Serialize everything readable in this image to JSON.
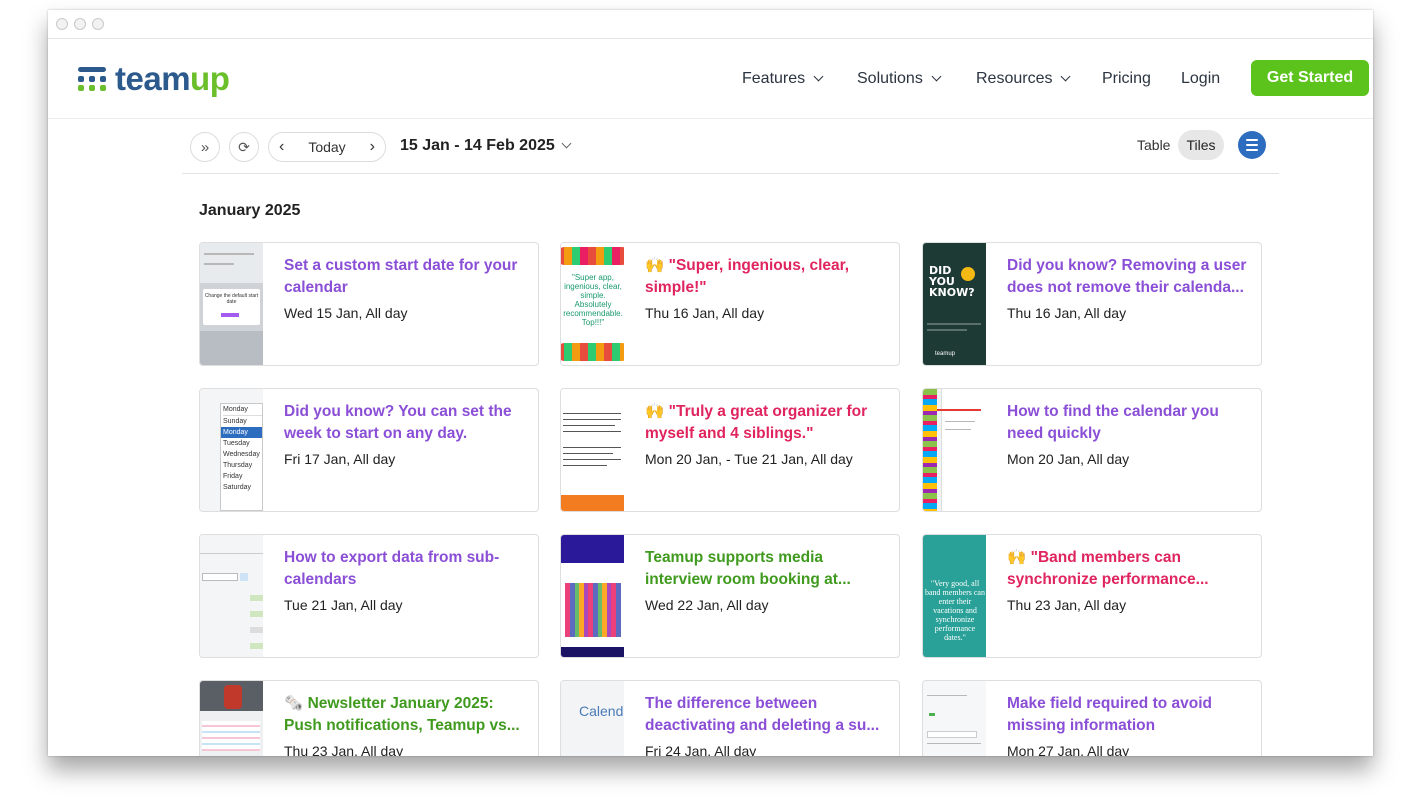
{
  "nav": {
    "logo_text_a": "team",
    "logo_text_b": "up",
    "features": "Features",
    "solutions": "Solutions",
    "resources": "Resources",
    "pricing": "Pricing",
    "login": "Login",
    "get_started": "Get Started"
  },
  "toolbar": {
    "today": "Today",
    "range": "15 Jan - 14 Feb 2025",
    "view_table": "Table",
    "view_tiles": "Tiles"
  },
  "month": "January 2025",
  "cards": [
    {
      "title": "Set a custom start date for your calendar",
      "date": "Wed 15 Jan, All day",
      "color": "#8a4fd6"
    },
    {
      "title": "🙌 \"Super, ingenious, clear, simple!\"",
      "date": "Thu 16 Jan, All day",
      "color": "#e0245e"
    },
    {
      "title": "Did you know? Removing a user does not remove their calenda...",
      "date": "Thu 16 Jan, All day",
      "color": "#8a4fd6"
    },
    {
      "title": "Did you know? You can set the week to start on any day.",
      "date": "Fri 17 Jan, All day",
      "color": "#8a4fd6"
    },
    {
      "title": "🙌 \"Truly a great organizer for myself and 4 siblings.\"",
      "date": "Mon 20 Jan, - Tue 21 Jan, All day",
      "color": "#e0245e"
    },
    {
      "title": "How to find the calendar you need quickly",
      "date": "Mon 20 Jan, All day",
      "color": "#8a4fd6"
    },
    {
      "title": "How to export data from sub-calendars",
      "date": "Tue 21 Jan, All day",
      "color": "#8a4fd6"
    },
    {
      "title": "Teamup supports media interview room booking at...",
      "date": "Wed 22 Jan, All day",
      "color": "#3f9a1e"
    },
    {
      "title": "🙌 \"Band members can synchronize performance...",
      "date": "Thu 23 Jan, All day",
      "color": "#e0245e"
    },
    {
      "title": "🗞️ Newsletter January 2025: Push notifications, Teamup vs...",
      "date": "Thu 23 Jan, All day",
      "color": "#3f9a1e"
    },
    {
      "title": "The difference between deactivating and deleting a su...",
      "date": "Fri 24 Jan, All day",
      "color": "#8a4fd6"
    },
    {
      "title": "Make field required to avoid missing information",
      "date": "Mon 27 Jan, All day",
      "color": "#8a4fd6"
    }
  ],
  "thumb_text": {
    "t1": "Change the default start date",
    "t2": "\"Super app, ingenious, clear, simple. Absolutely recommendable. Top!!!\"",
    "t3a": "DID",
    "t3b": "YOU",
    "t3c": "KNOW?",
    "t3d": "teamup",
    "t4_days": [
      "Monday",
      "Sunday",
      "Monday",
      "Tuesday",
      "Wednesday",
      "Thursday",
      "Friday",
      "Saturday"
    ],
    "t9": "\"Very good, all band members can enter their vacations and synchronize performance dates.\"",
    "t11": "Calendar"
  }
}
